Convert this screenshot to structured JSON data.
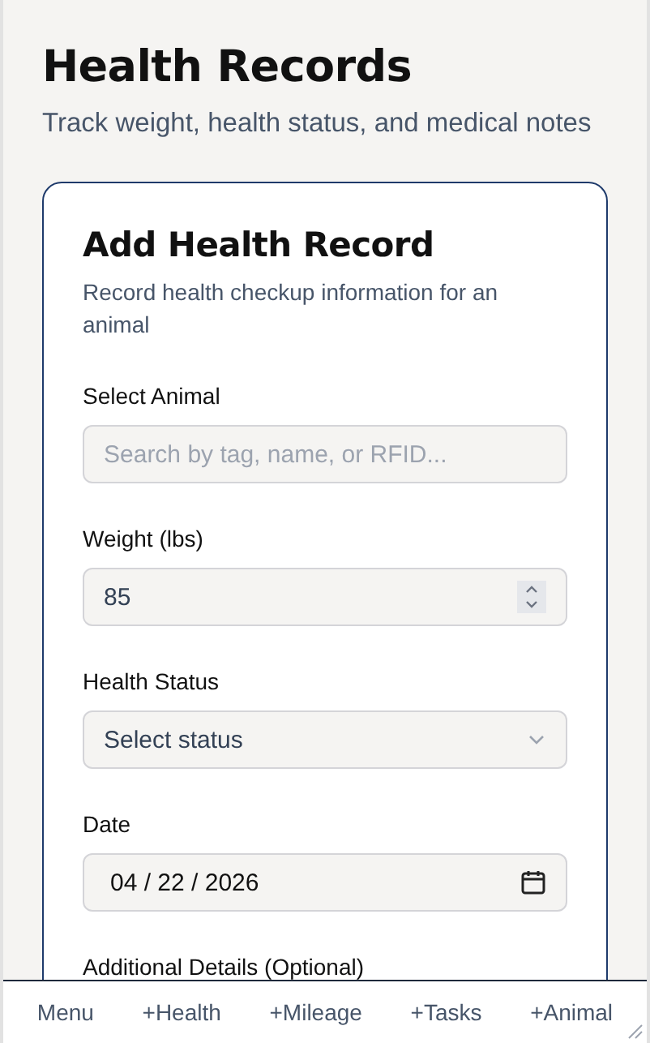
{
  "page": {
    "title": "Health Records",
    "subtitle": "Track weight, health status, and medical notes"
  },
  "form": {
    "title": "Add Health Record",
    "description": "Record health checkup information for an animal",
    "fields": [
      {
        "kind": "search",
        "label": "Select Animal",
        "placeholder": "Search by tag, name, or RFID..."
      },
      {
        "kind": "number",
        "label": "Weight (lbs)",
        "value": "85"
      },
      {
        "kind": "select",
        "label": "Health Status",
        "value": "Select status"
      },
      {
        "kind": "date",
        "label": "Date",
        "value": "04 / 22 / 2026"
      },
      {
        "kind": "label",
        "label": "Additional Details (Optional)"
      }
    ]
  },
  "bottom_nav": [
    "Menu",
    "+Health",
    "+Mileage",
    "+Tasks",
    "+Animal"
  ]
}
